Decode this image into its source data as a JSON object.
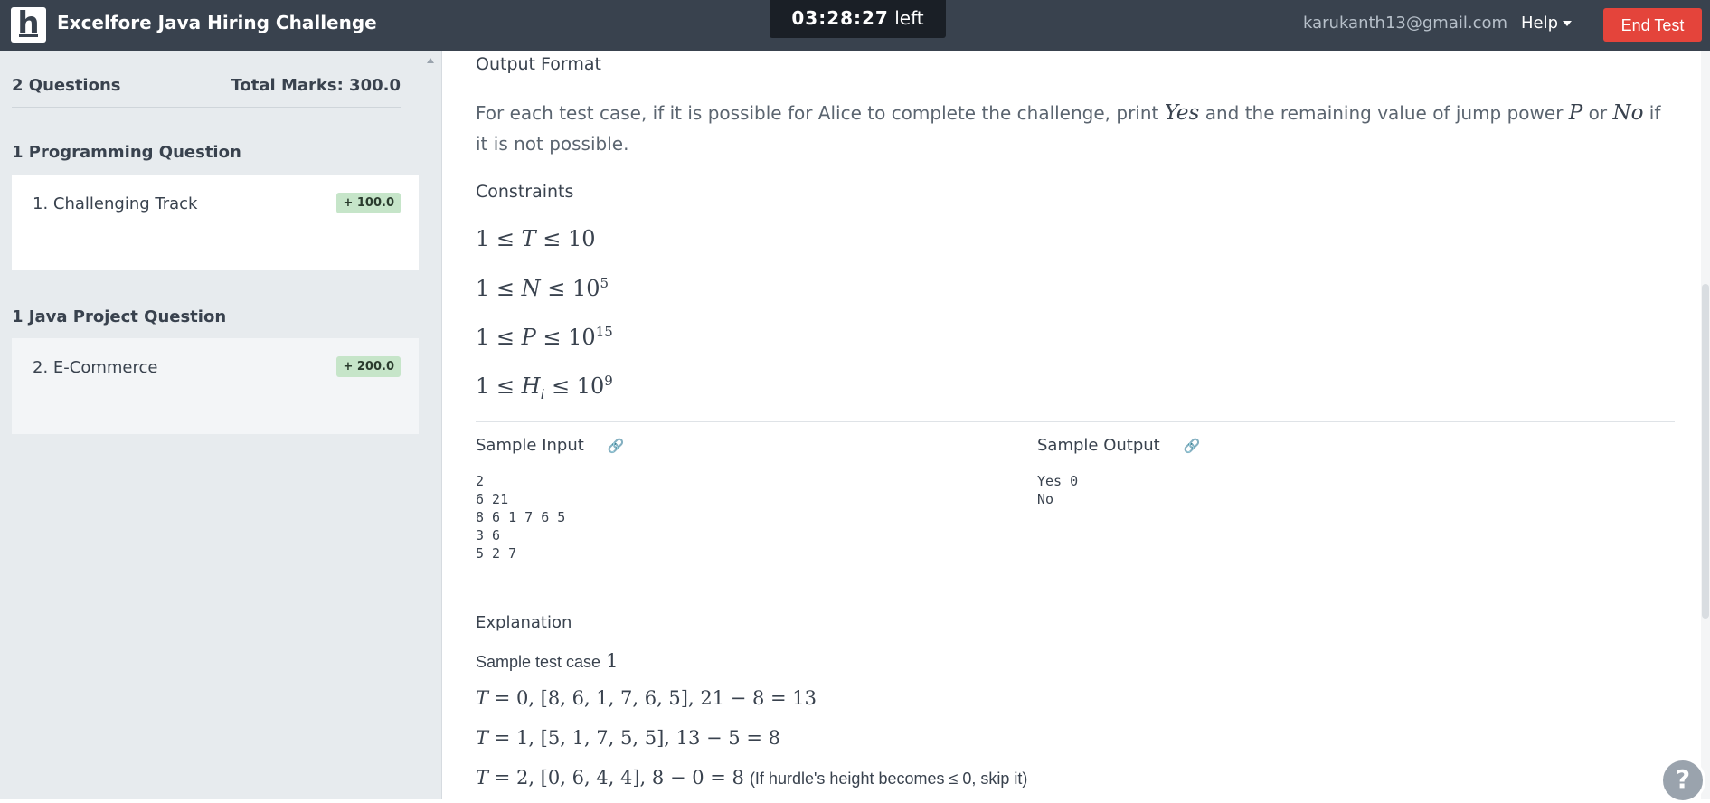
{
  "header": {
    "logo_letter": "h",
    "title": "Excelfore Java Hiring Challenge",
    "timer_value": "03:28:27",
    "timer_suffix": "left",
    "user_email": "karukanth13@gmail.com",
    "help_label": "Help",
    "end_test_label": "End Test"
  },
  "sidebar": {
    "questions_count": "2 Questions",
    "total_marks": "Total Marks: 300.0",
    "sections": [
      {
        "title": "1 Programming Question",
        "question": "1. Challenging Track",
        "marks": "+ 100.0"
      },
      {
        "title": "1 Java Project Question",
        "question": "2. E-Commerce",
        "marks": "+ 200.0"
      }
    ]
  },
  "problem": {
    "output_format_heading": "Output Format",
    "output_text_1": "For each test case, if it is possible for Alice to complete the challenge, print",
    "output_yes": "Yes",
    "output_text_2": "and the remaining value of jump power",
    "output_p": "P",
    "output_or": "or",
    "output_no": "No",
    "output_text_3": "if it is not possible.",
    "constraints_heading": "Constraints",
    "constraints": [
      {
        "lhs": "1 ≤ ",
        "var": "T",
        "rhs": " ≤ 10",
        "exp": ""
      },
      {
        "lhs": "1 ≤ ",
        "var": "N",
        "rhs": " ≤ 10",
        "exp": "5"
      },
      {
        "lhs": "1 ≤ ",
        "var": "P",
        "rhs": " ≤ 10",
        "exp": "15"
      },
      {
        "lhs": "1 ≤ ",
        "var": "H",
        "sub": "i",
        "rhs": " ≤ 10",
        "exp": "9"
      }
    ],
    "sample_input_heading": "Sample Input",
    "sample_input": "2\n6 21\n8 6 1 7 6 5\n3 6\n5 2 7",
    "sample_output_heading": "Sample Output",
    "sample_output": "Yes 0\nNo",
    "explanation_heading": "Explanation",
    "explanation_intro_text": "Sample test case",
    "explanation_intro_num": "1",
    "explanation_lines": [
      {
        "var": "T",
        "expr": " = 0, [8, 6, 1, 7, 6, 5], 21 − 8 = 13",
        "note": ""
      },
      {
        "var": "T",
        "expr": " = 1, [5, 1, 7, 5, 5], 13 − 5 = 8",
        "note": ""
      },
      {
        "var": "T",
        "expr": " = 2, [0, 6, 4, 4], 8 − 0 = 8",
        "note": "(If hurdle's height becomes ≤ 0, skip it)"
      }
    ]
  },
  "fab": {
    "icon": "?"
  },
  "colors": {
    "topbar": "#39424e",
    "end_test": "#e4443b",
    "sidebar": "#e7ebee",
    "marks_badge": "#c6e5c9",
    "link": "#1e8ae0"
  }
}
